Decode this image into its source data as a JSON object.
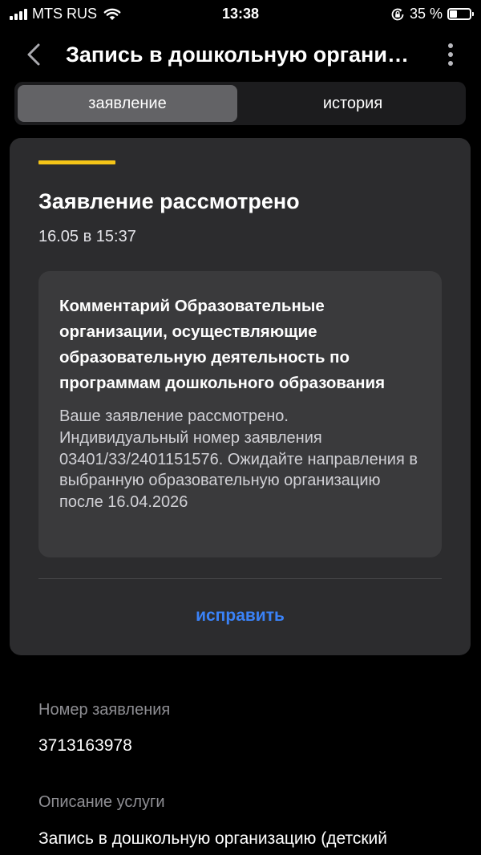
{
  "status_bar": {
    "carrier": "MTS RUS",
    "time": "13:38",
    "battery_percent": "35 %",
    "battery_level": 0.35,
    "icons": [
      "signal-icon",
      "wifi-icon",
      "rotation-lock-icon",
      "battery-icon"
    ]
  },
  "nav": {
    "title": "Запись в дошкольную организацию",
    "back_icon": "chevron-left-icon",
    "more_icon": "more-vertical-icon"
  },
  "tabs": [
    {
      "label": "заявление",
      "active": true
    },
    {
      "label": "история",
      "active": false
    }
  ],
  "status_card": {
    "title": "Заявление рассмотрено",
    "date": "16.05 в 15:37",
    "accent_color": "#f5c518",
    "comment": {
      "title": "Комментарий Образовательные организации, осуществляющие образовательную деятельность по программам дошкольного образования",
      "body": "Ваше заявление рассмотрено. Индивидуальный номер заявления 03401/33/2401151576. Ожидайте направления в выбранную образовательную организацию после 16.04.2026"
    },
    "action_label": "исправить",
    "action_color": "#3a82f7"
  },
  "details": {
    "number_label": "Номер заявления",
    "number_value": "3713163978",
    "description_label": "Описание услуги",
    "description_value": "Запись в дошкольную организацию (детский"
  }
}
